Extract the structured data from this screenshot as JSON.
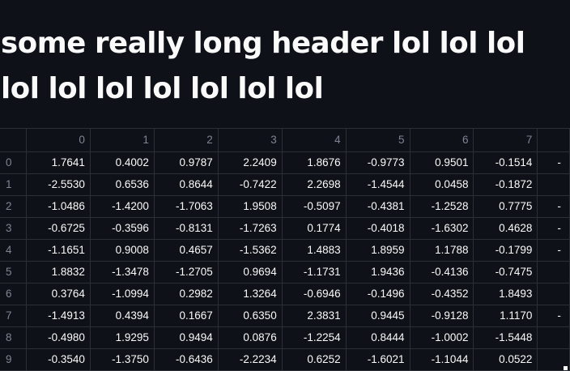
{
  "header": {
    "title": "some really long header lol lol lol lol lol lol lol lol lol lol"
  },
  "dataframe": {
    "columns": [
      "0",
      "1",
      "2",
      "3",
      "4",
      "5",
      "6",
      "7"
    ],
    "rows": [
      {
        "index": "0",
        "values": [
          "1.7641",
          "0.4002",
          "0.9787",
          "2.2409",
          "1.8676",
          "-0.9773",
          "0.9501",
          "-0.1514"
        ],
        "overflow": "-"
      },
      {
        "index": "1",
        "values": [
          "-2.5530",
          "0.6536",
          "0.8644",
          "-0.7422",
          "2.2698",
          "-1.4544",
          "0.0458",
          "-0.1872"
        ],
        "overflow": ""
      },
      {
        "index": "2",
        "values": [
          "-1.0486",
          "-1.4200",
          "-1.7063",
          "1.9508",
          "-0.5097",
          "-0.4381",
          "-1.2528",
          "0.7775"
        ],
        "overflow": "-"
      },
      {
        "index": "3",
        "values": [
          "-0.6725",
          "-0.3596",
          "-0.8131",
          "-1.7263",
          "0.1774",
          "-0.4018",
          "-1.6302",
          "0.4628"
        ],
        "overflow": "-"
      },
      {
        "index": "4",
        "values": [
          "-1.1651",
          "0.9008",
          "0.4657",
          "-1.5362",
          "1.4883",
          "1.8959",
          "1.1788",
          "-0.1799"
        ],
        "overflow": "-"
      },
      {
        "index": "5",
        "values": [
          "1.8832",
          "-1.3478",
          "-1.2705",
          "0.9694",
          "-1.1731",
          "1.9436",
          "-0.4136",
          "-0.7475"
        ],
        "overflow": ""
      },
      {
        "index": "6",
        "values": [
          "0.3764",
          "-1.0994",
          "0.2982",
          "1.3264",
          "-0.6946",
          "-0.1496",
          "-0.4352",
          "1.8493"
        ],
        "overflow": ""
      },
      {
        "index": "7",
        "values": [
          "-1.4913",
          "0.4394",
          "0.1667",
          "0.6350",
          "2.3831",
          "0.9445",
          "-0.9128",
          "1.1170"
        ],
        "overflow": "-"
      },
      {
        "index": "8",
        "values": [
          "-0.4980",
          "1.9295",
          "0.9494",
          "0.0876",
          "-1.2254",
          "0.8444",
          "-1.0002",
          "-1.5448"
        ],
        "overflow": ""
      },
      {
        "index": "9",
        "values": [
          "-0.3540",
          "-1.3750",
          "-0.6436",
          "-2.2234",
          "0.6252",
          "-1.6021",
          "-1.1044",
          "0.0522"
        ],
        "overflow": ""
      }
    ]
  }
}
